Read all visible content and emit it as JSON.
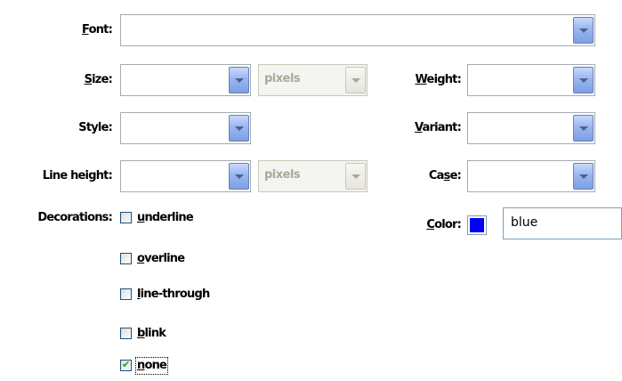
{
  "font": {
    "label_accel": "F",
    "label_rest": "ont:",
    "value": ""
  },
  "size": {
    "label_accel": "S",
    "label_rest": "ize:",
    "value": "",
    "unit": "pixels"
  },
  "weight": {
    "label_accel": "W",
    "label_rest": "eight:",
    "value": ""
  },
  "style": {
    "label": "Style:",
    "value": ""
  },
  "variant": {
    "label_accel": "V",
    "label_rest": "ariant:",
    "value": ""
  },
  "line_height": {
    "label": "Line height:",
    "value": "",
    "unit": "pixels"
  },
  "case": {
    "label_pre": "Ca",
    "label_accel": "s",
    "label_post": "e:",
    "value": ""
  },
  "decorations": {
    "label": "Decorations:",
    "items": [
      {
        "label_accel": "u",
        "label_rest": "nderline",
        "checked": false
      },
      {
        "label_accel": "o",
        "label_rest": "verline",
        "checked": false
      },
      {
        "label_accel": "l",
        "label_rest": "ine-through",
        "checked": false
      },
      {
        "label_accel": "b",
        "label_rest": "link",
        "checked": false
      },
      {
        "label_accel": "n",
        "label_rest": "one",
        "checked": true
      }
    ]
  },
  "color": {
    "label_accel": "C",
    "label_rest": "olor:",
    "value": "blue",
    "swatch": "#0000ff"
  },
  "colors": {
    "check_mark": "#21a121",
    "disabled_text": "#aca899"
  }
}
